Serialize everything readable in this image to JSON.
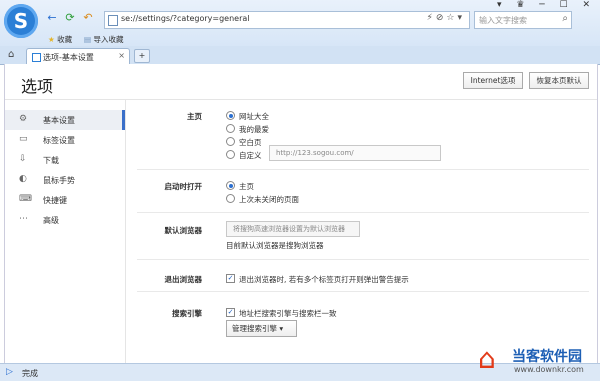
{
  "toolbar": {
    "logo_letter": "S",
    "back": "←",
    "reload": "⟳",
    "undo": "↶",
    "url": "se://settings/?category=general",
    "addr_tools": "⚡⊘☆▾",
    "search_placeholder": "输入文字搜索",
    "window_controls": "▾ ♛ ─ ☐ ✕"
  },
  "bookmarks": {
    "fav": "收藏",
    "import": "导入收藏"
  },
  "tabs": {
    "active_label": "选项-基本设置",
    "close": "×",
    "new_tab": "+",
    "home": "⌂"
  },
  "page": {
    "title": "选项",
    "internet_options": "Internet选项",
    "restore_defaults": "恢复本页默认"
  },
  "sidebar": {
    "items": [
      {
        "icon": "⚙",
        "label": "基本设置"
      },
      {
        "icon": "▭",
        "label": "标签设置"
      },
      {
        "icon": "⇩",
        "label": "下载"
      },
      {
        "icon": "◐",
        "label": "鼠标手势"
      },
      {
        "icon": "⌨",
        "label": "快捷键"
      },
      {
        "icon": "⋯",
        "label": "高级"
      }
    ]
  },
  "home": {
    "label": "主页",
    "options": [
      "网址大全",
      "我的最爱",
      "空白页",
      "自定义"
    ],
    "custom_url": "http://123.sogou.com/"
  },
  "startup": {
    "label": "启动时打开",
    "options": [
      "主页",
      "上次未关闭的页面"
    ]
  },
  "default_browser": {
    "label": "默认浏览器",
    "button_text": "将搜狗高速浏览器设置为默认浏览器",
    "status": "目前默认浏览器是搜狗浏览器"
  },
  "exit": {
    "label": "退出浏览器",
    "option": "退出浏览器时, 若有多个标签页打开则弹出警告提示"
  },
  "search_engine": {
    "label": "搜索引擎",
    "option": "地址栏搜索引擎与搜索栏一致",
    "manage": "管理搜索引擎"
  },
  "status": {
    "icon": "▷",
    "text": "完成"
  },
  "watermark": {
    "cn": "当客软件园",
    "en": "www.downkr.com"
  },
  "colors": {
    "accent": "#2b6fd0",
    "watermark_red": "#e23b1a"
  }
}
